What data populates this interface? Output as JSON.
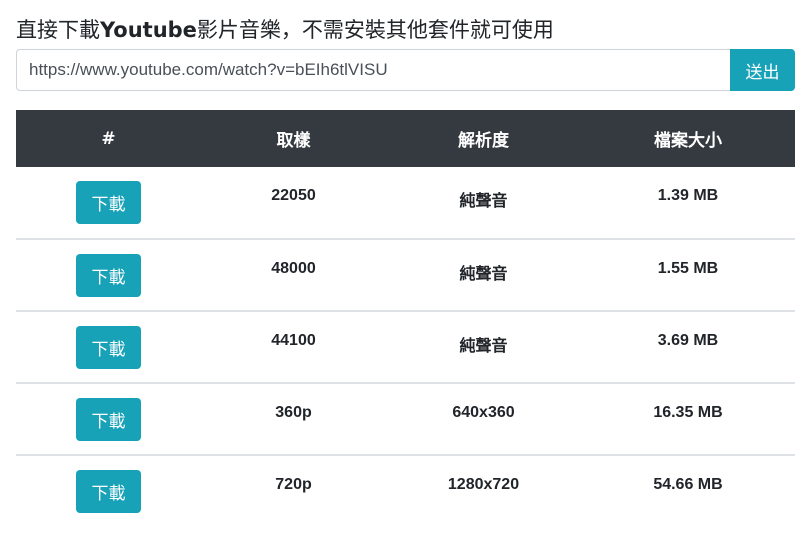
{
  "header": {
    "title_pre": "直接下載",
    "title_brand": "Youtube",
    "title_post": "影片音樂，不需安裝其他套件就可使用"
  },
  "form": {
    "url_value": "https://www.youtube.com/watch?v=bEIh6tlVISU",
    "submit_label": "送出"
  },
  "colors": {
    "accent": "#17a2b8",
    "table_header": "#343a40"
  },
  "table": {
    "headers": [
      "#",
      "取樣",
      "解析度",
      "檔案大小"
    ],
    "rows": [
      {
        "action": "下載",
        "sample": "22050",
        "resolution": "純聲音",
        "size": "1.39 MB"
      },
      {
        "action": "下載",
        "sample": "48000",
        "resolution": "純聲音",
        "size": "1.55 MB"
      },
      {
        "action": "下載",
        "sample": "44100",
        "resolution": "純聲音",
        "size": "3.69 MB"
      },
      {
        "action": "下載",
        "sample": "360p",
        "resolution": "640x360",
        "size": "16.35 MB"
      },
      {
        "action": "下載",
        "sample": "720p",
        "resolution": "1280x720",
        "size": "54.66 MB"
      }
    ]
  }
}
